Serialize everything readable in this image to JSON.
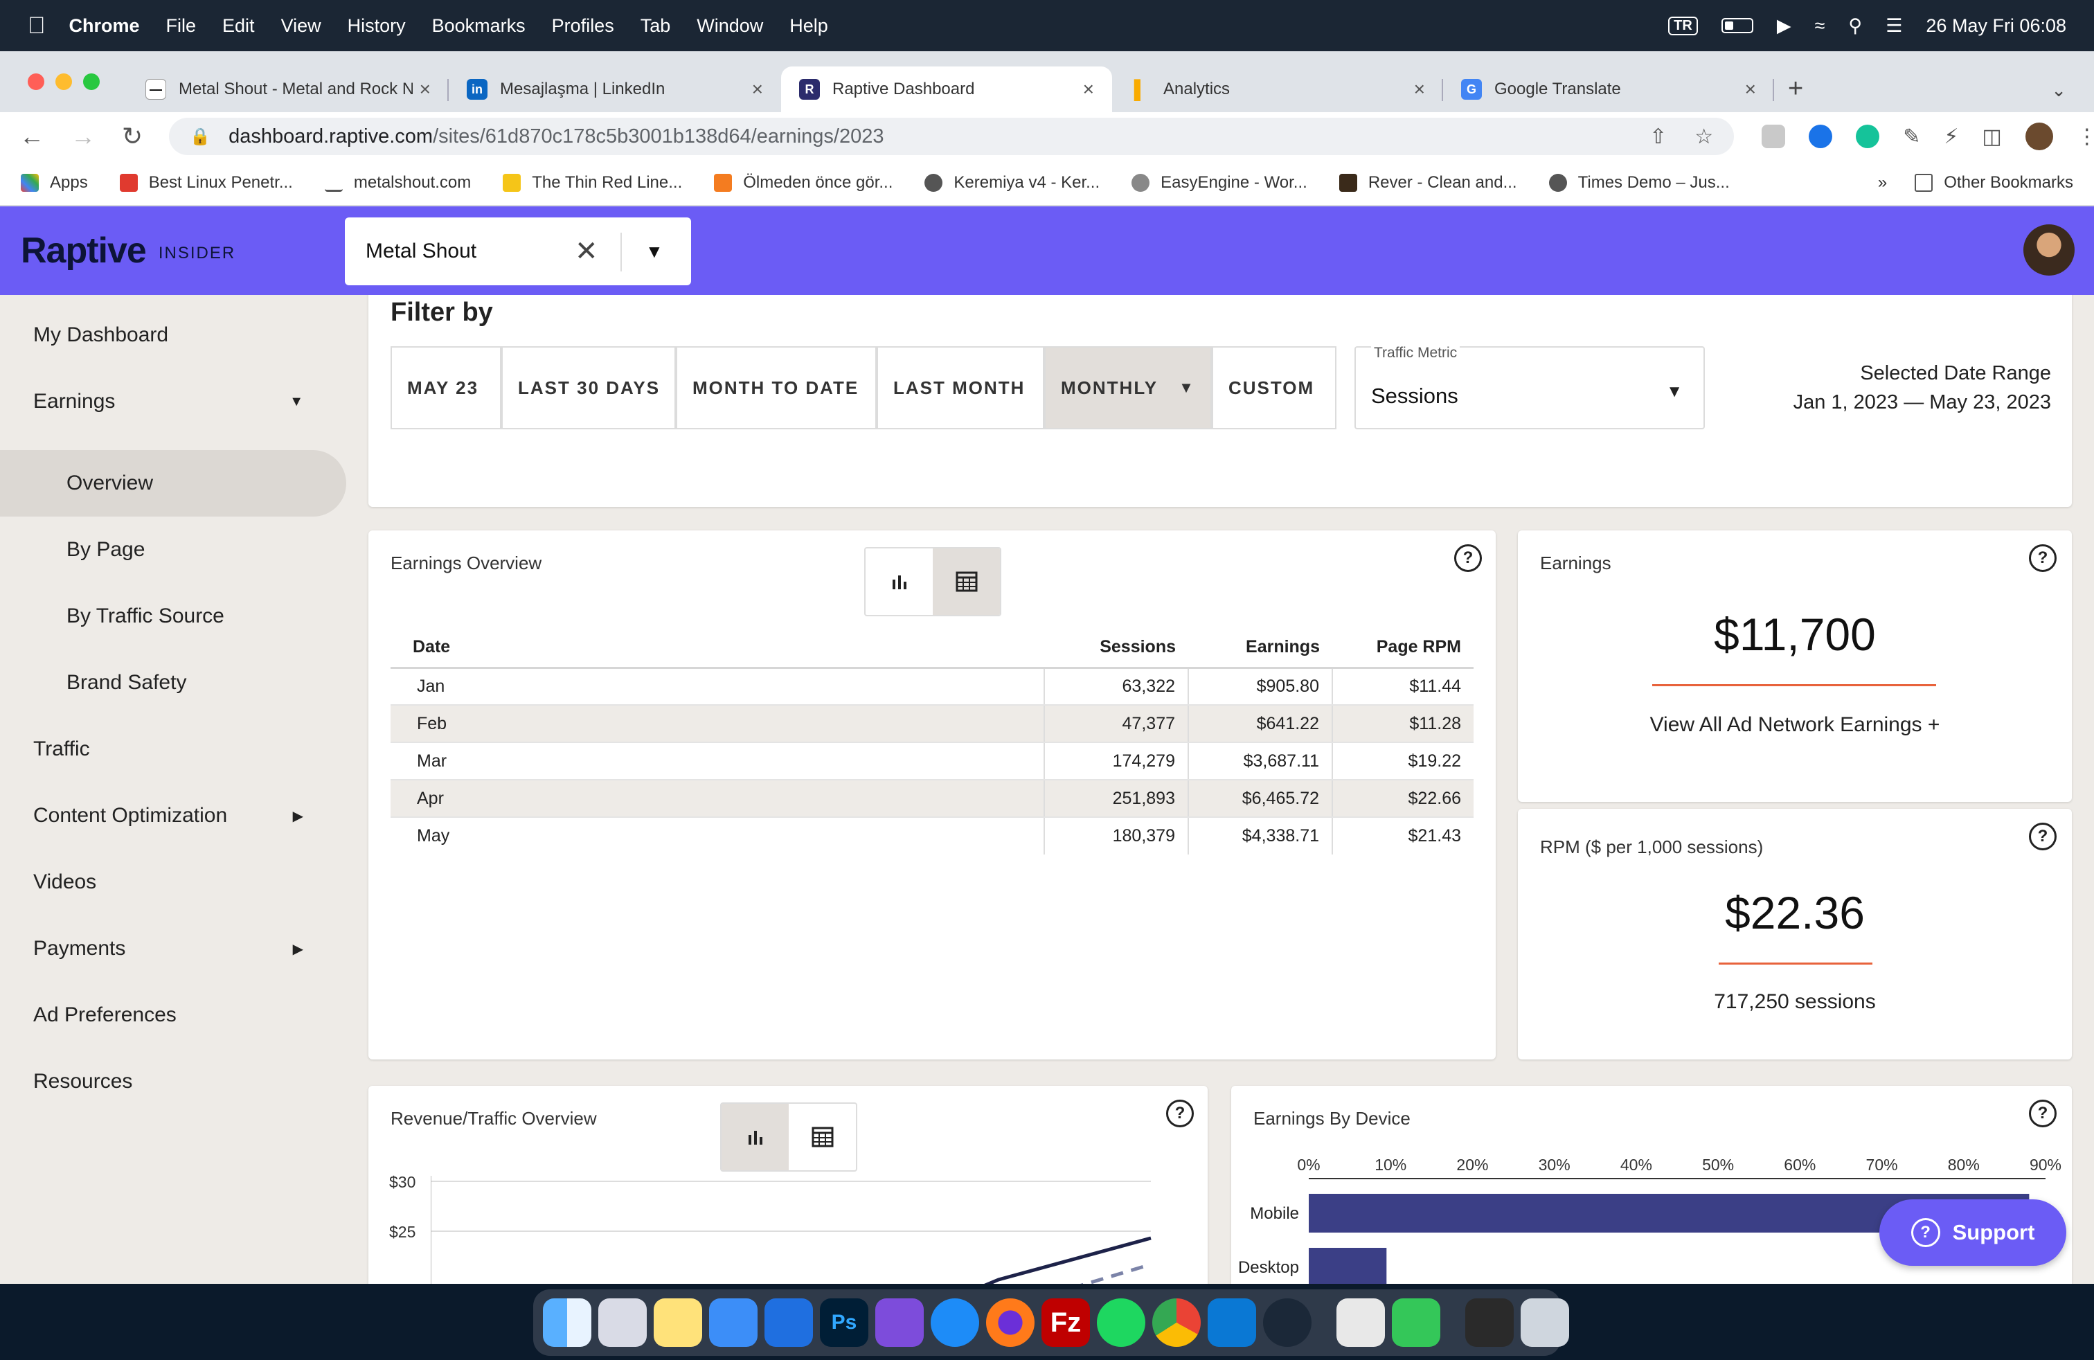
{
  "menubar": {
    "app": "Chrome",
    "items": [
      "File",
      "Edit",
      "View",
      "History",
      "Bookmarks",
      "Profiles",
      "Tab",
      "Window",
      "Help"
    ],
    "input_source": "TR",
    "datetime": "26 May Fri  06:08"
  },
  "tabs": [
    {
      "label": "Metal Shout - Metal and Rock N",
      "close": "×"
    },
    {
      "label": "Mesajlaşma | LinkedIn",
      "close": "×"
    },
    {
      "label": "Raptive Dashboard",
      "close": "×"
    },
    {
      "label": "Analytics",
      "close": "×"
    },
    {
      "label": "Google Translate",
      "close": "×"
    }
  ],
  "address": {
    "host": "dashboard.raptive.com",
    "path": "/sites/61d870c178c5b3001b138d64/earnings/2023"
  },
  "bookmarks": {
    "items": [
      "Apps",
      "Best Linux Penetr...",
      "metalshout.com",
      "The Thin Red Line...",
      "Ölmeden önce gör...",
      "Keremiya v4 - Ker...",
      "EasyEngine - Wor...",
      "Rever - Clean and...",
      "Times Demo – Jus..."
    ],
    "more": "»",
    "other": "Other Bookmarks"
  },
  "app": {
    "logo": "Raptive",
    "logo_sub": "INSIDER",
    "site_select": "Metal Shout"
  },
  "sidebar": {
    "items": [
      {
        "label": "My Dashboard"
      },
      {
        "label": "Earnings"
      },
      {
        "label": "Overview"
      },
      {
        "label": "By Page"
      },
      {
        "label": "By Traffic Source"
      },
      {
        "label": "Brand Safety"
      },
      {
        "label": "Traffic"
      },
      {
        "label": "Content Optimization"
      },
      {
        "label": "Videos"
      },
      {
        "label": "Payments"
      },
      {
        "label": "Ad Preferences"
      },
      {
        "label": "Resources"
      }
    ]
  },
  "filter": {
    "title": "Filter by",
    "options": [
      "MAY 23",
      "LAST 30 DAYS",
      "MONTH TO DATE",
      "LAST MONTH",
      "MONTHLY",
      "CUSTOM"
    ],
    "selected": "MONTHLY",
    "metric_label": "Traffic Metric",
    "metric_value": "Sessions",
    "range_label": "Selected Date Range",
    "range_value": "Jan 1, 2023 — May 23, 2023"
  },
  "earnings_overview": {
    "title": "Earnings Overview",
    "view": "table",
    "columns": [
      "Date",
      "Sessions",
      "Earnings",
      "Page RPM"
    ],
    "rows": [
      [
        "Jan",
        "63,322",
        "$905.80",
        "$11.44"
      ],
      [
        "Feb",
        "47,377",
        "$641.22",
        "$11.28"
      ],
      [
        "Mar",
        "174,279",
        "$3,687.11",
        "$19.22"
      ],
      [
        "Apr",
        "251,893",
        "$6,465.72",
        "$22.66"
      ],
      [
        "May",
        "180,379",
        "$4,338.71",
        "$21.43"
      ]
    ]
  },
  "earnings_card": {
    "title": "Earnings",
    "value": "$11,700",
    "link": "View All Ad Network Earnings +"
  },
  "rpm_card": {
    "title": "RPM ($ per 1,000 sessions)",
    "value": "$22.36",
    "sessions": "717,250 sessions"
  },
  "revenue_traffic": {
    "title": "Revenue/Traffic Overview",
    "view": "chart",
    "y_ticks": [
      "$30",
      "$25"
    ]
  },
  "earnings_by_device": {
    "title": "Earnings By Device",
    "x_ticks": [
      "0%",
      "10%",
      "20%",
      "30%",
      "40%",
      "50%",
      "60%",
      "70%",
      "80%",
      "90%"
    ]
  },
  "chart_data": {
    "type": "bar",
    "orientation": "horizontal",
    "title": "Earnings By Device",
    "categories": [
      "Mobile",
      "Desktop"
    ],
    "values": [
      88,
      9.5
    ],
    "unit": "%",
    "xlim": [
      0,
      90
    ],
    "grid": false,
    "colors": [
      "#3b3f86"
    ]
  },
  "support": {
    "label": "Support"
  },
  "colors": {
    "brand": "#6b5cf5",
    "accent_underline": "#e8633c",
    "bar": "#3b3f86",
    "selected_bg": "#e2deda"
  },
  "dock_icons": [
    "finder-icon",
    "launchpad-icon",
    "notes-icon",
    "mail-icon",
    "xcode-icon",
    "photoshop-icon",
    "affinity-icon",
    "safari-icon",
    "firefox-icon",
    "filezilla-icon",
    "spotify-icon",
    "chrome-icon",
    "vscode-icon",
    "steam-icon",
    "unity-icon",
    "numbers-icon",
    "preview-icon",
    "trash-icon"
  ]
}
